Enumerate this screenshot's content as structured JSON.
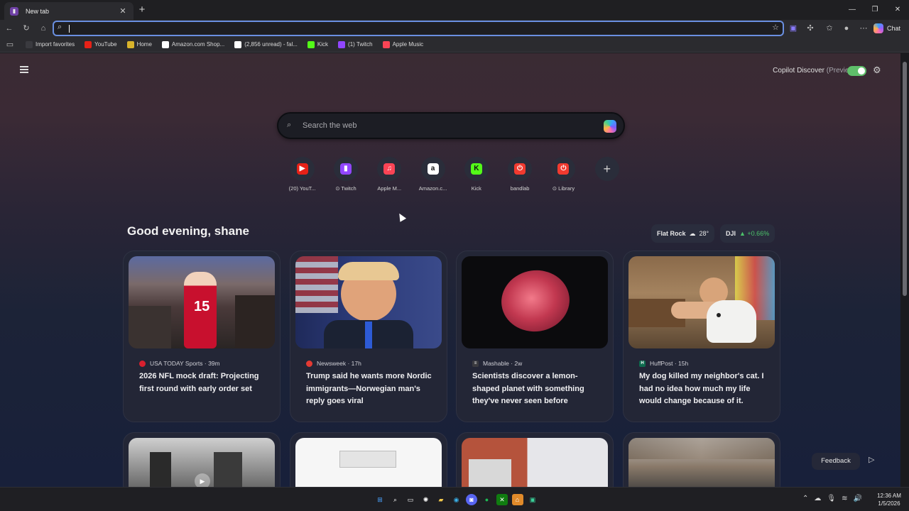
{
  "browser": {
    "tab": {
      "title": "New tab"
    },
    "address_bar": {
      "value": ""
    },
    "chat_label": "Chat",
    "bookmarks": [
      {
        "label": "Import favorites",
        "icon": "folder-icon",
        "color": "#3a3a3f"
      },
      {
        "label": "YouTube",
        "icon": "youtube-icon",
        "color": "#e62117"
      },
      {
        "label": "Home",
        "icon": "home-icon",
        "color": "#d8b32b"
      },
      {
        "label": "Amazon.com Shop...",
        "icon": "amazon-icon",
        "color": "#ffffff"
      },
      {
        "label": "(2,856 unread) - fal...",
        "icon": "mail-icon",
        "color": "#ffffff"
      },
      {
        "label": "Kick",
        "icon": "kick-icon",
        "color": "#53fc18"
      },
      {
        "label": "(1) Twitch",
        "icon": "twitch-icon",
        "color": "#9146ff"
      },
      {
        "label": "Apple Music",
        "icon": "apple-music-icon",
        "color": "#fa4455"
      }
    ]
  },
  "header": {
    "copilot_discover": "Copilot Discover",
    "preview": "(Preview)",
    "toggle_on": true
  },
  "search": {
    "placeholder": "Search the web"
  },
  "quick_links": [
    {
      "label": "(20) YouT...",
      "icon": "youtube-icon",
      "color": "#e62117",
      "glyph": "▶"
    },
    {
      "label": "⊙ Twitch",
      "icon": "twitch-icon",
      "color": "#9146ff",
      "glyph": "▮"
    },
    {
      "label": "Apple M...",
      "icon": "apple-music-icon",
      "color": "#fa4455",
      "glyph": "♫"
    },
    {
      "label": "Amazon.c...",
      "icon": "amazon-icon",
      "color": "#ffffff",
      "glyph": "a"
    },
    {
      "label": "Kick",
      "icon": "kick-icon",
      "color": "#53fc18",
      "glyph": "K"
    },
    {
      "label": "bandlab",
      "icon": "bandlab-icon",
      "color": "#f03a2f",
      "glyph": "⏻"
    },
    {
      "label": "⊙ Library",
      "icon": "bandlab-icon",
      "color": "#f03a2f",
      "glyph": "⏻"
    }
  ],
  "feed": {
    "greeting": "Good evening, shane",
    "weather": {
      "location": "Flat Rock",
      "temp": "28°"
    },
    "stock": {
      "symbol": "DJI",
      "change": "▲ +0.66%"
    },
    "cards": [
      {
        "source": "USA TODAY Sports",
        "age": "39m",
        "source_color": "#d8202f",
        "headline": "2026 NFL mock draft: Projecting first round with early order set"
      },
      {
        "source": "Newsweek",
        "age": "17h",
        "source_color": "#e33a33",
        "headline": "Trump said he wants more Nordic immigrants—Norwegian man's reply goes viral"
      },
      {
        "source": "Mashable",
        "age": "2w",
        "source_color": "#3a3a3f",
        "headline": "Scientists discover a lemon-shaped planet with something they've never seen before"
      },
      {
        "source": "HuffPost",
        "age": "15h",
        "source_color": "#0e6b4e",
        "headline": "My dog killed my neighbor's cat. I had no idea how much my life would change because of it."
      }
    ]
  },
  "feedback_label": "Feedback",
  "taskbar": {
    "time": "12:36 AM",
    "date": "1/5/2026"
  }
}
